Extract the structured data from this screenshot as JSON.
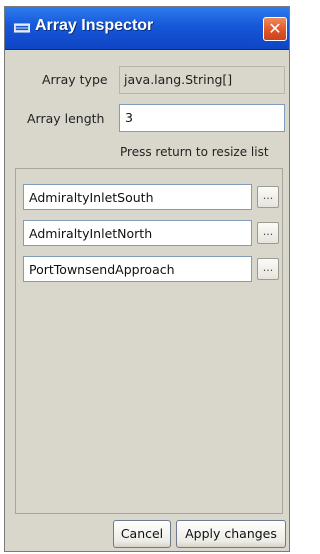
{
  "window": {
    "title": "Array Inspector",
    "close_symbol": "✕"
  },
  "fields": {
    "array_type_label": "Array type",
    "array_type_value": "java.lang.String[]",
    "array_length_label": "Array length",
    "array_length_value": "3",
    "hint": "Press return to resize list"
  },
  "items": [
    {
      "value": "AdmiraltyInletSouth",
      "button_label": "..."
    },
    {
      "value": "AdmiraltyInletNorth",
      "button_label": "..."
    },
    {
      "value": "PortTownsendApproach",
      "button_label": "..."
    }
  ],
  "buttons": {
    "cancel": "Cancel",
    "apply": "Apply changes"
  },
  "colors": {
    "titlebar": "#1557d8",
    "close": "#e0552a",
    "window_bg": "#d9d6cc"
  }
}
